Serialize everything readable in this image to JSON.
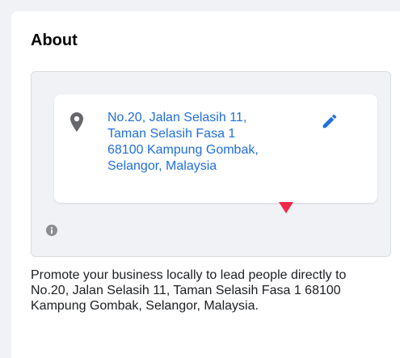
{
  "about": {
    "title": "About"
  },
  "address": {
    "lines": [
      "No.20, Jalan Selasih 11,",
      "Taman Selasih Fasa 1",
      "68100 Kampung Gombak,",
      "Selangor, Malaysia"
    ]
  },
  "promo": {
    "text": "Promote your business locally to lead people directly to No.20, Jalan Selasih 11, Taman Selasih Fasa 1 68100 Kampung Gombak, Selangor, Malaysia."
  },
  "icons": {
    "pin": "location-pin-icon",
    "edit": "pencil-icon",
    "marker": "map-marker-icon",
    "info": "info-icon"
  },
  "colors": {
    "link": "#216fdb",
    "marker": "#f02849",
    "icon_gray": "#65676b"
  }
}
